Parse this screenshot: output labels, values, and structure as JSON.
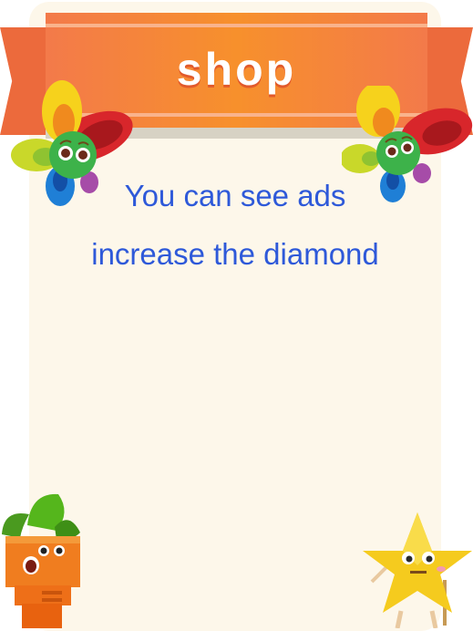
{
  "title": "shop",
  "info": {
    "line1": "You can see ads",
    "line2": "increase the diamond"
  },
  "colors": {
    "ribbon": "#f7902c",
    "panel": "#fdf7ea",
    "text": "#2e59d9"
  },
  "decorations": [
    "flower-left",
    "flower-right",
    "carrot-character",
    "star-character"
  ]
}
